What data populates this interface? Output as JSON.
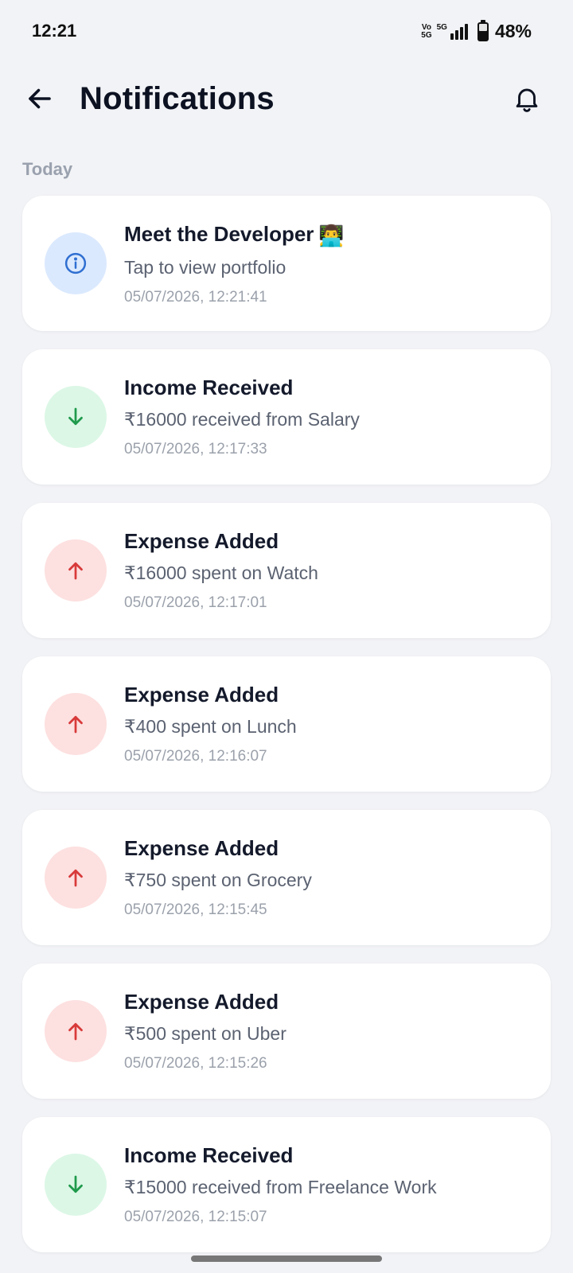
{
  "status_bar": {
    "time": "12:21",
    "volte": "Vo\n5G",
    "network": "5G",
    "battery": "48%"
  },
  "header": {
    "title": "Notifications",
    "back_icon": "arrow-left-icon",
    "bell_icon": "bell-icon"
  },
  "section": {
    "label": "Today"
  },
  "notifications": [
    {
      "kind": "info",
      "icon": "info-icon",
      "title": "Meet the Developer",
      "emoji": "👨‍💻",
      "subtitle": "Tap to view portfolio",
      "time": "05/07/2026, 12:21:41"
    },
    {
      "kind": "income",
      "icon": "arrow-down-icon",
      "title": "Income Received",
      "subtitle": "₹16000 received from Salary",
      "time": "05/07/2026, 12:17:33"
    },
    {
      "kind": "expense",
      "icon": "arrow-up-icon",
      "title": "Expense Added",
      "subtitle": "₹16000 spent on Watch",
      "time": "05/07/2026, 12:17:01"
    },
    {
      "kind": "expense",
      "icon": "arrow-up-icon",
      "title": "Expense Added",
      "subtitle": "₹400 spent on Lunch",
      "time": "05/07/2026, 12:16:07"
    },
    {
      "kind": "expense",
      "icon": "arrow-up-icon",
      "title": "Expense Added",
      "subtitle": "₹750 spent on Grocery",
      "time": "05/07/2026, 12:15:45"
    },
    {
      "kind": "expense",
      "icon": "arrow-up-icon",
      "title": "Expense Added",
      "subtitle": "₹500 spent on Uber",
      "time": "05/07/2026, 12:15:26"
    },
    {
      "kind": "income",
      "icon": "arrow-down-icon",
      "title": "Income Received",
      "subtitle": "₹15000 received from Freelance Work",
      "time": "05/07/2026, 12:15:07"
    }
  ],
  "colors": {
    "info": "#2f6fd1",
    "income": "#1f9a4c",
    "expense": "#d83a3a"
  }
}
